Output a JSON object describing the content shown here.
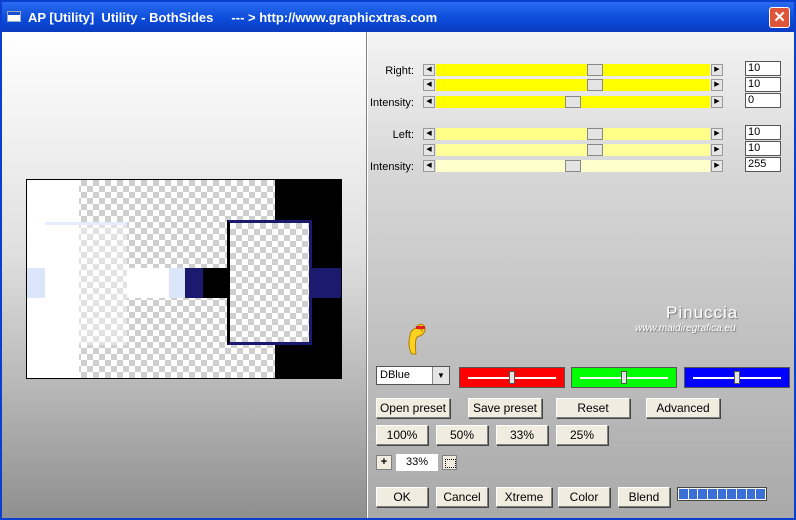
{
  "window": {
    "title": "AP [Utility]  Utility - BothSides     --- > http://www.graphicxtras.com",
    "close_glyph": "✕"
  },
  "right_group": {
    "label_right": "Right:",
    "label_intensity": "Intensity:",
    "sliders": [
      {
        "value": "10",
        "level": 0.58
      },
      {
        "value": "10",
        "level": 0.58
      },
      {
        "value": "0",
        "level": 0.5
      }
    ]
  },
  "left_group": {
    "label_left": "Left:",
    "label_intensity": "Intensity:",
    "sliders": [
      {
        "value": "10",
        "level": 0.58
      },
      {
        "value": "10",
        "level": 0.58
      },
      {
        "value": "255",
        "level": 0.5
      }
    ]
  },
  "watermark": {
    "name": "Pinuccia",
    "url": "www.maidiregrafica.eu"
  },
  "preset_select": {
    "value": "DBlue"
  },
  "colors": {
    "red": "#ff0000",
    "green": "#00ff00",
    "blue": "#0000ff"
  },
  "buttons": {
    "open_preset": "Open preset",
    "save_preset": "Save preset",
    "reset": "Reset",
    "advanced": "Advanced",
    "zoom100": "100%",
    "zoom50": "50%",
    "zoom33": "33%",
    "zoom25": "25%",
    "ok": "OK",
    "cancel": "Cancel",
    "xtreme": "Xtreme",
    "color": "Color",
    "blend": "Blend"
  },
  "zoom": {
    "plus": "+",
    "value": "33%"
  },
  "progress": {
    "segments": 9
  }
}
